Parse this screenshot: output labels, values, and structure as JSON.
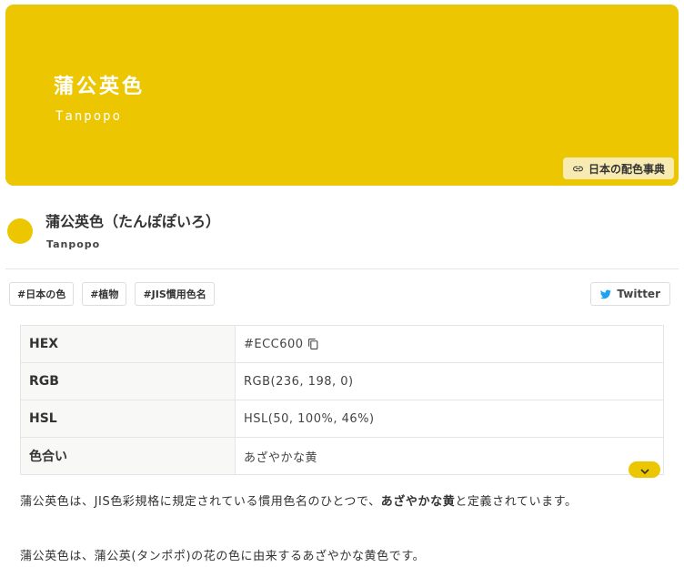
{
  "colors": {
    "accent": "#ECC600",
    "button_bg": "#F8EBB2",
    "twitter": "#1DA1F2"
  },
  "hero": {
    "name": "蒲公英色",
    "romaji": "Tanpopo",
    "dictionary_button": "日本の配色事典"
  },
  "header": {
    "title": "蒲公英色（たんぽぽいろ）",
    "subtitle": "Tanpopo"
  },
  "tags": [
    "#日本の色",
    "#植物",
    "#JIS慣用色名"
  ],
  "share": {
    "twitter_label": "Twitter"
  },
  "table": {
    "rows": [
      {
        "label": "HEX",
        "value": "#ECC600"
      },
      {
        "label": "RGB",
        "value": "RGB(236, 198, 0)"
      },
      {
        "label": "HSL",
        "value": "HSL(50, 100%, 46%)"
      },
      {
        "label": "色合い",
        "value": "あざやかな黄"
      }
    ]
  },
  "description": {
    "p1_before": "蒲公英色は、JIS色彩規格に規定されている慣用色名のひとつで、",
    "p1_bold": "あざやかな黄",
    "p1_after": "と定義されています。",
    "p2": "蒲公英色は、蒲公英(タンポポ)の花の色に由来するあざやかな黄色です。"
  }
}
